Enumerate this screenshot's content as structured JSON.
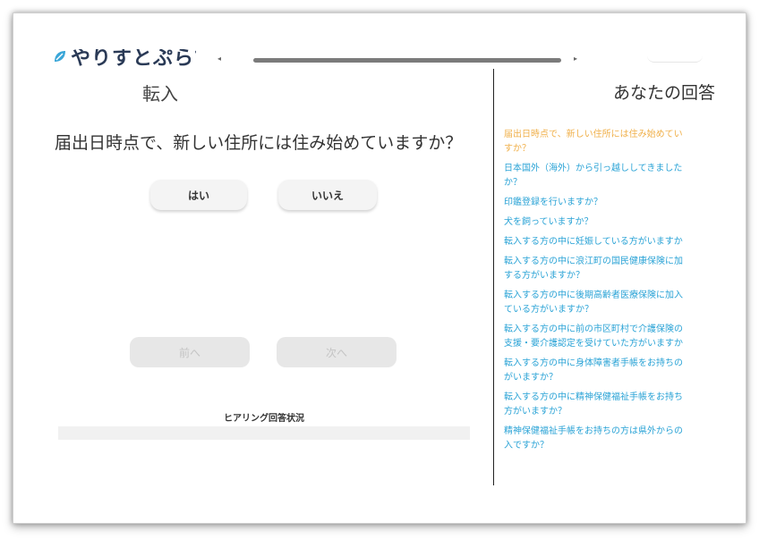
{
  "header": {
    "logo_text": "やりすとぷらす",
    "scroll_left": "◂",
    "scroll_right": "▸"
  },
  "main": {
    "title": "転入",
    "question": "届出日時点で、新しい住所には住み始めていますか？",
    "yes_label": "はい",
    "no_label": "いいえ",
    "prev_label": "前へ",
    "next_label": "次へ",
    "status_label": "ヒアリング回答状況"
  },
  "sidebar": {
    "title": "あなたの回答",
    "items": [
      {
        "text": "届出日時点で、新しい住所には住み始めてい\nすか？",
        "current": true
      },
      {
        "text": "日本国外（海外）から引っ越ししてきました\nか？",
        "current": false
      },
      {
        "text": "印鑑登録を行いますか？",
        "current": false
      },
      {
        "text": "犬を飼っていますか？",
        "current": false
      },
      {
        "text": "転入する方の中に妊娠している方がいますか",
        "current": false
      },
      {
        "text": "転入する方の中に浪江町の国民健康保険に加\nする方がいますか？",
        "current": false
      },
      {
        "text": "転入する方の中に後期高齢者医療保険に加入\nている方がいますか？",
        "current": false
      },
      {
        "text": "転入する方の中に前の市区町村で介護保険の\n支援・要介護認定を受けていた方がいますか",
        "current": false
      },
      {
        "text": "転入する方の中に身体障害者手帳をお持ちの\nがいますか？",
        "current": false
      },
      {
        "text": "転入する方の中に精神保健福祉手帳をお持ち\n方がいますか？",
        "current": false
      },
      {
        "text": "精神保健福祉手帳をお持ちの方は県外からの\n入ですか？",
        "current": false
      }
    ]
  },
  "colors": {
    "link": "#2aa3d6",
    "current": "#f0b04a"
  }
}
